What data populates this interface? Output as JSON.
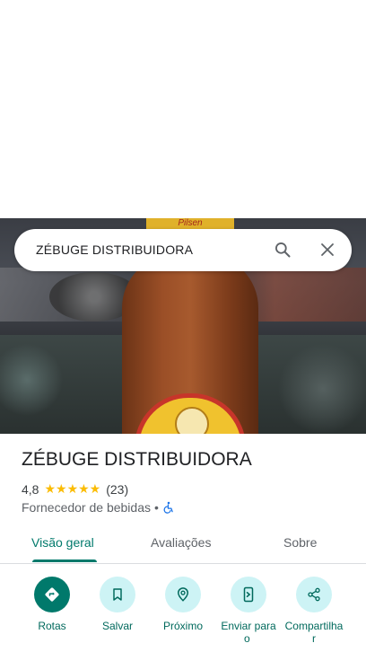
{
  "search": {
    "query": "ZÉBUGE DISTRIBUIDORA"
  },
  "hero": {
    "bottle_label_text": "Pilsen"
  },
  "place": {
    "name": "ZÉBUGE DISTRIBUIDORA",
    "rating": "4,8",
    "stars": "★★★★★",
    "review_count": "(23)",
    "category": "Fornecedor de bebidas",
    "separator": "•"
  },
  "tabs": [
    {
      "label": "Visão geral",
      "active": true
    },
    {
      "label": "Avaliações",
      "active": false
    },
    {
      "label": "Sobre",
      "active": false
    }
  ],
  "actions": [
    {
      "label": "Rotas",
      "icon": "directions-icon"
    },
    {
      "label": "Salvar",
      "icon": "bookmark-icon"
    },
    {
      "label": "Próximo",
      "icon": "nearby-icon"
    },
    {
      "label": "Enviar para\no ",
      "icon": "send-to-phone-icon"
    },
    {
      "label": "Compartilha\nr",
      "icon": "share-icon"
    }
  ],
  "colors": {
    "accent": "#00796b",
    "action_bg": "#cdf3f5",
    "star": "#fbbc04"
  }
}
